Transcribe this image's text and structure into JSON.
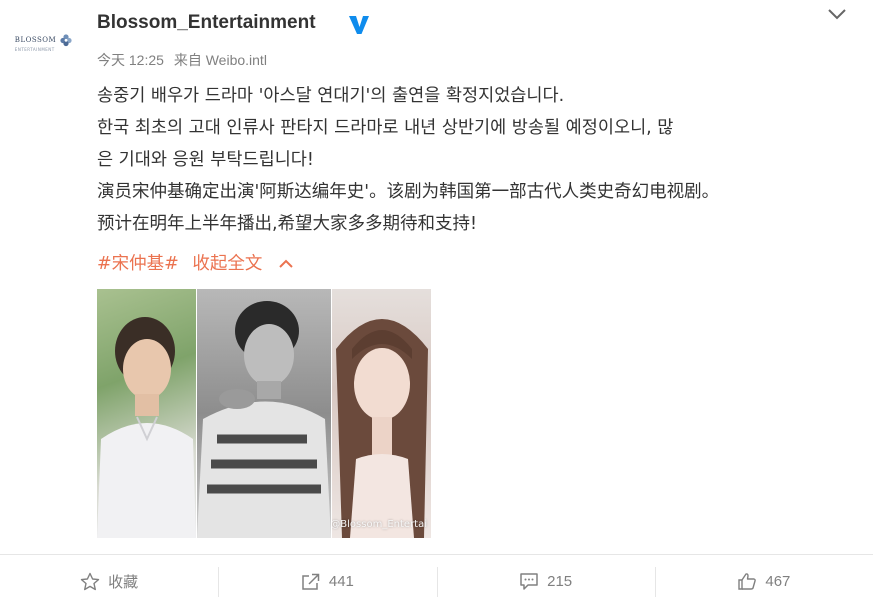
{
  "post": {
    "avatar": {
      "logo_text": "BLOSSOM",
      "logo_sub": "ENTERTAINMENT"
    },
    "username": "Blossom_Entertainment",
    "verified_icon": "verified-v-icon",
    "menu_icon": "chevron-down-icon",
    "meta": {
      "time": "今天 12:25",
      "source": "来自 Weibo.intl"
    },
    "body_lines": [
      "송중기 배우가 드라마 '아스달 연대기'의 출연을 확정지었습니다.",
      "한국 최초의 고대 인류사 판타지 드라마로 내년 상반기에 방송될 예정이오니, 많",
      "은 기대와 응원 부탁드립니다!",
      "演员宋仲基确定出演'阿斯达编年史'。该剧为韩国第一部古代人类史奇幻电视剧。",
      "预计在明年上半年播出,希望大家多多期待和支持!"
    ],
    "hashtag": "#宋仲基#",
    "collapse_label": "收起全文",
    "watermark": "@Blossom_Entertai"
  },
  "actions": {
    "favorite_label": "收藏",
    "repost_count": "441",
    "comment_count": "215",
    "like_count": "467"
  },
  "colors": {
    "accent": "#eb7350",
    "verified": "#0f8ced",
    "muted": "#808080"
  }
}
